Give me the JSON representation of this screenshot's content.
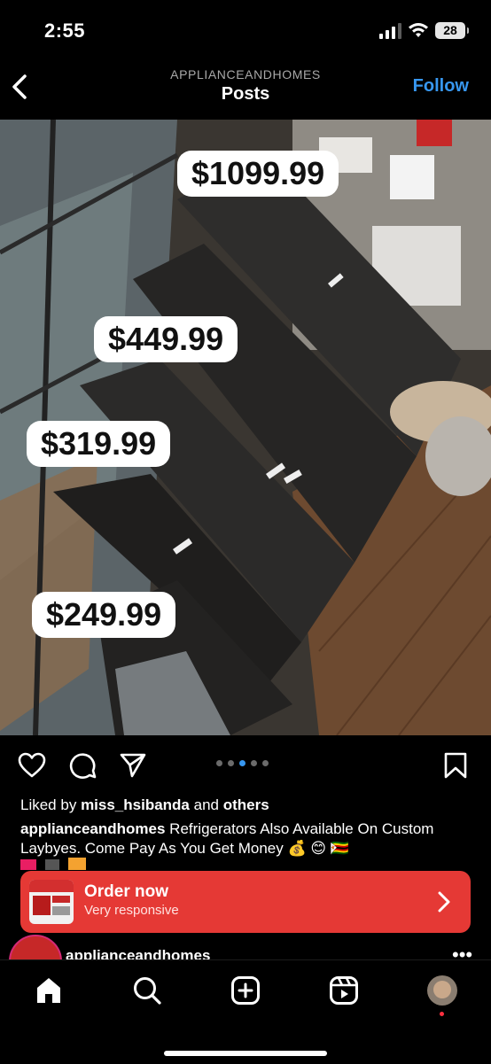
{
  "status": {
    "time": "2:55",
    "battery": "28"
  },
  "header": {
    "account": "APPLIANCEANDHOMES",
    "title": "Posts",
    "follow_label": "Follow"
  },
  "photo": {
    "prices": [
      "$1099.99",
      "$449.99",
      "$319.99",
      "$249.99"
    ]
  },
  "carousel": {
    "count": 5,
    "active_index": 2
  },
  "likes": {
    "prefix": "Liked by",
    "user": "miss_hsibanda",
    "middle": "and",
    "suffix": "others"
  },
  "caption": {
    "user": "applianceandhomes",
    "text": "Refrigerators Also Available On Custom Laybyes. Come Pay As You Get Money 💰 😊 🇿🇼"
  },
  "order": {
    "label": "Order now",
    "sub": "Very responsive"
  },
  "next_post": {
    "user": "applianceandhomes"
  },
  "icons": {
    "back": "chevron-left-icon",
    "heart": "heart-icon",
    "comment": "comment-icon",
    "share": "paper-plane-icon",
    "save": "bookmark-icon",
    "home": "home-icon",
    "search": "search-icon",
    "create": "plus-square-icon",
    "reels": "reels-icon"
  },
  "colors": {
    "follow": "#3797f0",
    "order_bg": "#e53935",
    "active_dot": "#3797f0"
  }
}
